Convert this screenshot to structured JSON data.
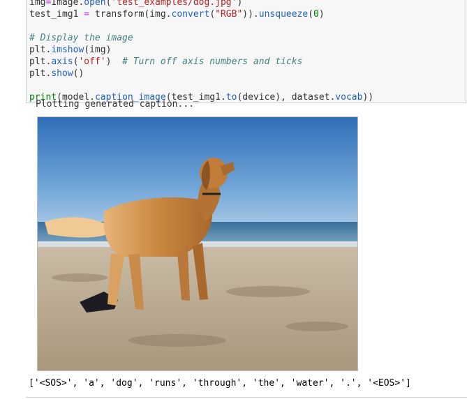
{
  "code_cell": {
    "lines": [
      [
        {
          "t": "img",
          "c": ""
        },
        {
          "t": "=",
          "c": "o"
        },
        {
          "t": "Image.",
          "c": ""
        },
        {
          "t": "open",
          "c": "f"
        },
        {
          "t": "(",
          "c": ""
        },
        {
          "t": "'test_examples/dog.jpg'",
          "c": "s"
        },
        {
          "t": ")",
          "c": ""
        }
      ],
      [
        {
          "t": "test_img1 ",
          "c": ""
        },
        {
          "t": "=",
          "c": "o"
        },
        {
          "t": " transform(img.",
          "c": ""
        },
        {
          "t": "convert",
          "c": "f"
        },
        {
          "t": "(",
          "c": ""
        },
        {
          "t": "\"RGB\"",
          "c": "s"
        },
        {
          "t": ")).",
          "c": ""
        },
        {
          "t": "unsqueeze",
          "c": "f"
        },
        {
          "t": "(",
          "c": ""
        },
        {
          "t": "0",
          "c": "n"
        },
        {
          "t": ")",
          "c": ""
        }
      ],
      [],
      [
        {
          "t": "# Display the image",
          "c": "c"
        }
      ],
      [
        {
          "t": "plt.",
          "c": ""
        },
        {
          "t": "imshow",
          "c": "f"
        },
        {
          "t": "(img)",
          "c": ""
        }
      ],
      [
        {
          "t": "plt.",
          "c": ""
        },
        {
          "t": "axis",
          "c": "f"
        },
        {
          "t": "(",
          "c": ""
        },
        {
          "t": "'off'",
          "c": "s"
        },
        {
          "t": ")  ",
          "c": ""
        },
        {
          "t": "# Turn off axis numbers and ticks",
          "c": "c"
        }
      ],
      [
        {
          "t": "plt.",
          "c": ""
        },
        {
          "t": "show",
          "c": "f"
        },
        {
          "t": "()",
          "c": ""
        }
      ],
      [],
      [
        {
          "t": "print",
          "c": "k"
        },
        {
          "t": "(model.",
          "c": ""
        },
        {
          "t": "caption_image",
          "c": "f"
        },
        {
          "t": "(test_img1.",
          "c": ""
        },
        {
          "t": "to",
          "c": "f"
        },
        {
          "t": "(device), dataset.",
          "c": ""
        },
        {
          "t": "vocab",
          "c": "f"
        },
        {
          "t": "))",
          "c": ""
        }
      ]
    ]
  },
  "output": {
    "clipped_text": "Plotting generated caption...",
    "image_alt": "dog on beach",
    "caption_tokens": "['<SOS>', 'a', 'dog', 'runs', 'through', 'the', 'water', '.', '<EOS>']"
  }
}
